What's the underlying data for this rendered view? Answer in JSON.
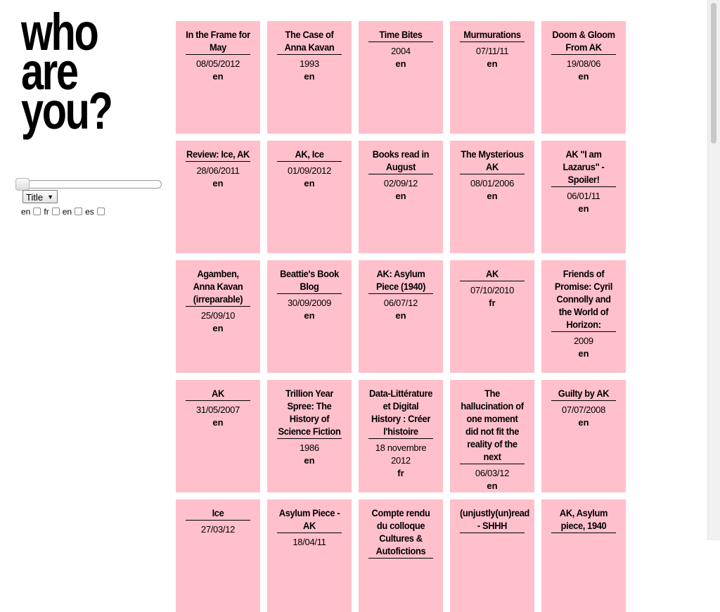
{
  "logo": {
    "line1": "who",
    "line2": "are",
    "line3": "you?"
  },
  "filters": {
    "sort_select": {
      "selected": "Title"
    },
    "languages": [
      {
        "label": "en"
      },
      {
        "label": "fr"
      },
      {
        "label": "en"
      },
      {
        "label": "es"
      }
    ]
  },
  "cards": [
    {
      "title": "In the Frame for May",
      "date": "08/05/2012",
      "lang": "en"
    },
    {
      "title": "The Case of Anna Kavan",
      "date": "1993",
      "lang": "en"
    },
    {
      "title": "Time Bites",
      "date": "2004",
      "lang": "en"
    },
    {
      "title": "Murmurations",
      "date": "07/11/11",
      "lang": "en"
    },
    {
      "title": "Doom & Gloom From AK",
      "date": "19/08/06",
      "lang": "en"
    },
    {
      "title": "Review: Ice, AK",
      "date": "28/06/2011",
      "lang": "en"
    },
    {
      "title": "AK, Ice",
      "date": "01/09/2012",
      "lang": "en"
    },
    {
      "title": "Books read in August",
      "date": "02/09/12",
      "lang": "en"
    },
    {
      "title": "The Mysterious AK",
      "date": "08/01/2006",
      "lang": "en"
    },
    {
      "title": "AK \"I am Lazarus\" - Spoiler!",
      "date": "06/01/11",
      "lang": "en"
    },
    {
      "title": "Agamben, Anna Kavan (irreparable)",
      "date": "25/09/10",
      "lang": "en"
    },
    {
      "title": "Beattie's Book Blog",
      "date": "30/09/2009",
      "lang": "en"
    },
    {
      "title": "AK: Asylum Piece (1940)",
      "date": "06/07/12",
      "lang": "en"
    },
    {
      "title": "AK",
      "date": "07/10/2010",
      "lang": "fr"
    },
    {
      "title": "Friends of Promise: Cyril Connolly and the World of Horizon:",
      "date": "2009",
      "lang": "en"
    },
    {
      "title": "AK",
      "date": "31/05/2007",
      "lang": "en"
    },
    {
      "title": "Trillion Year Spree: The History of Science Fiction",
      "date": "1986",
      "lang": "en"
    },
    {
      "title": "Data-Littérature et Digital History : Créer l'histoire",
      "date": "18 novembre 2012",
      "lang": "fr"
    },
    {
      "title": "The hallucination of one moment did not fit the reality of the next",
      "date": "06/03/12",
      "lang": "en"
    },
    {
      "title": "Guilty by AK",
      "date": "07/07/2008",
      "lang": "en"
    },
    {
      "title": "Ice",
      "date": "27/03/12",
      "lang": ""
    },
    {
      "title": "Asylum Piece - AK",
      "date": "18/04/11",
      "lang": ""
    },
    {
      "title": "Compte rendu du colloque Cultures & Autofictions",
      "date": "",
      "lang": ""
    },
    {
      "title": "(unjustly(un)read - SHHH",
      "date": "",
      "lang": ""
    },
    {
      "title": "AK, Asylum piece, 1940",
      "date": "",
      "lang": ""
    }
  ]
}
